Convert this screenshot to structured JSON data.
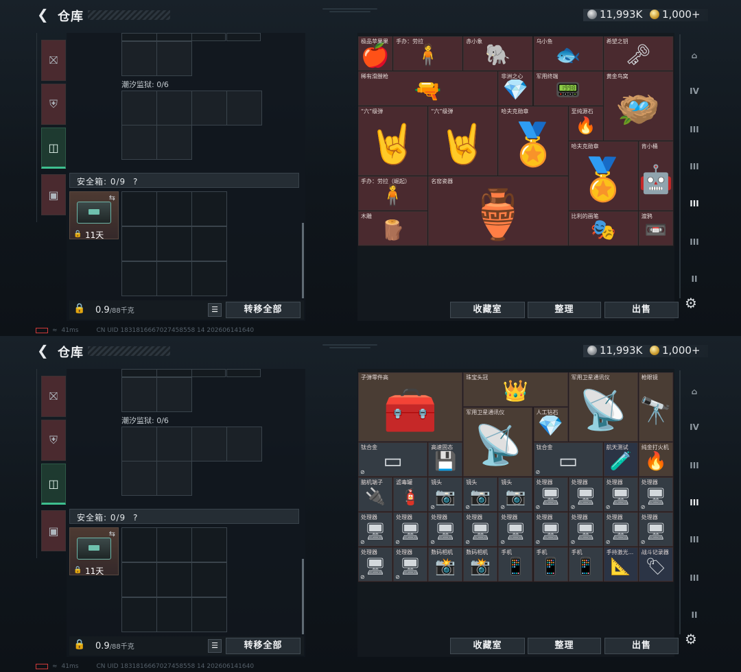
{
  "header": {
    "title": "仓库",
    "silver": "11,993K",
    "gold": "1,000+"
  },
  "left": {
    "prison_label": "潮汐监狱: 0/6",
    "safe_label": "安全箱: 0/9",
    "safe_help": "?",
    "safe_days": "11天",
    "weight": "0.9",
    "weight_unit": "/88千克",
    "transfer_all": "转移全部"
  },
  "right": {
    "btn_collection": "收藏室",
    "btn_sort": "整理",
    "btn_sell": "出售"
  },
  "sidebar_right": [
    "I",
    "IV",
    "III",
    "III",
    "III",
    "III",
    "III",
    "II"
  ],
  "status": {
    "ping": "41ms",
    "uid": "CN UID 1831816667027458558 14 202606141640"
  },
  "screen1_items": [
    {
      "name": "极品苹果果",
      "icon": "🍎",
      "color": "red",
      "id": "apple"
    },
    {
      "name": "手办：劳拉",
      "icon": "🧍",
      "color": "red",
      "id": "figure-lara"
    },
    {
      "name": "赤小象",
      "icon": "🐘",
      "color": "red",
      "id": "red-elephant"
    },
    {
      "name": "乌小鱼",
      "icon": "🐟",
      "color": "red",
      "id": "black-fish"
    },
    {
      "name": "希望之钥",
      "icon": "🗝",
      "color": "red",
      "id": "key-of-hope"
    },
    {
      "name": "稀有滑膛枪",
      "icon": "🔫",
      "color": "red",
      "id": "musket"
    },
    {
      "name": "非洲之心",
      "icon": "💎",
      "color": "red",
      "id": "heart-of-africa"
    },
    {
      "name": "军用终端",
      "icon": "📟",
      "color": "red",
      "id": "military-terminal"
    },
    {
      "name": "黄金鸟窝",
      "icon": "🪺",
      "color": "red",
      "id": "golden-nest"
    },
    {
      "name": "“六”级弹",
      "icon": "🤘",
      "color": "red",
      "id": "six-ammo-1"
    },
    {
      "name": "“六”级弹",
      "icon": "🤘",
      "color": "red",
      "id": "six-ammo-2"
    },
    {
      "name": "哈夫克勋章",
      "icon": "🏅",
      "color": "red",
      "id": "haavk-medal-1"
    },
    {
      "name": "至纯源石",
      "icon": "🔥",
      "color": "red",
      "id": "pure-stone"
    },
    {
      "name": "哈夫克勋章",
      "icon": "🏅",
      "color": "red",
      "id": "haavk-medal-2"
    },
    {
      "name": "肯小桶",
      "icon": "🤖",
      "color": "red",
      "id": "ken-bucket"
    },
    {
      "name": "手办：劳拉（崛起）",
      "icon": "🧍",
      "color": "red",
      "id": "figure-lara-rise"
    },
    {
      "name": "名窑瓷器",
      "icon": "🏺",
      "color": "red",
      "id": "porcelain"
    },
    {
      "name": "木雕",
      "icon": "🪵",
      "color": "red",
      "id": "wood-carving"
    },
    {
      "name": "比利的画笔",
      "icon": "🎭",
      "color": "red",
      "id": "billy-doll"
    },
    {
      "name": "渡鸦",
      "icon": "📼",
      "color": "red",
      "id": "raven"
    }
  ],
  "screen2_items": [
    {
      "name": "子弹零件高",
      "icon": "🧰",
      "color": "brn",
      "id": "ammo-parts"
    },
    {
      "name": "珠宝头冠",
      "icon": "👑",
      "color": "brn",
      "id": "tiara"
    },
    {
      "name": "军用卫星通讯仪",
      "icon": "📡",
      "color": "brn",
      "id": "sat-1"
    },
    {
      "name": "枪眼镜",
      "icon": "🔭",
      "color": "brn",
      "id": "scope"
    },
    {
      "name": "军用卫星通讯仪",
      "icon": "📡",
      "color": "brn",
      "id": "sat-2"
    },
    {
      "name": "人工钻石",
      "icon": "💎",
      "color": "brn",
      "id": "diamond"
    },
    {
      "name": "钛合金",
      "icon": "▭",
      "color": "gry",
      "id": "ti-1"
    },
    {
      "name": "高速固态",
      "icon": "💾",
      "color": "gry",
      "id": "ssd"
    },
    {
      "name": "钛合金",
      "icon": "▭",
      "color": "gry",
      "id": "ti-2"
    },
    {
      "name": "航天测试",
      "icon": "🧪",
      "color": "blu",
      "id": "space-test"
    },
    {
      "name": "纯金打火机",
      "icon": "🔥",
      "color": "brn",
      "id": "lighter"
    },
    {
      "name": "脑机端子",
      "icon": "🔌",
      "color": "gry",
      "id": "bci"
    },
    {
      "name": "滤毒罐",
      "icon": "🧯",
      "color": "gry",
      "id": "filter"
    },
    {
      "name": "镜头",
      "icon": "📷",
      "color": "gry",
      "id": "lens-1"
    },
    {
      "name": "镜头",
      "icon": "📷",
      "color": "gry",
      "id": "lens-2"
    },
    {
      "name": "镜头",
      "icon": "📷",
      "color": "gry",
      "id": "lens-3"
    },
    {
      "name": "处理器",
      "icon": "🖥",
      "color": "gry",
      "id": "cpu"
    },
    {
      "name": "数码相机",
      "icon": "📸",
      "color": "gry",
      "id": "camera"
    },
    {
      "name": "手机",
      "icon": "📱",
      "color": "gry",
      "id": "phone"
    },
    {
      "name": "手持激光...",
      "icon": "📐",
      "color": "blu",
      "id": "laser"
    },
    {
      "name": "战斗记录器",
      "icon": "🏷",
      "color": "blu",
      "id": "recorder"
    }
  ]
}
